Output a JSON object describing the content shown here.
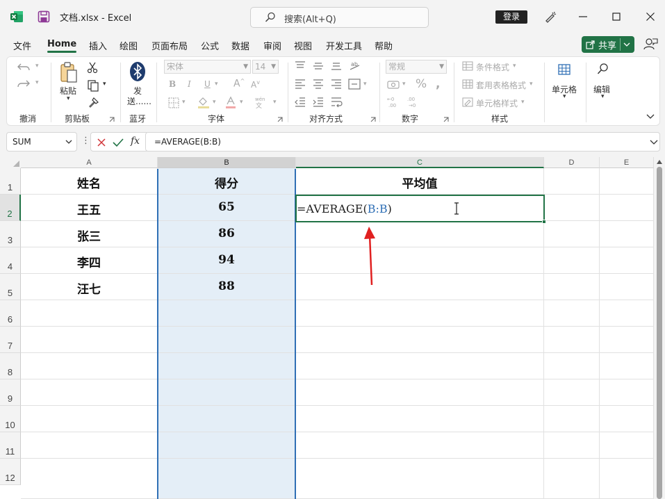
{
  "window": {
    "doc_title": "文档.xlsx  -  Excel",
    "search_placeholder": "搜索(Alt+Q)",
    "login_label": "登录"
  },
  "menu": {
    "tabs": [
      "文件",
      "Home",
      "插入",
      "绘图",
      "页面布局",
      "公式",
      "数据",
      "审阅",
      "视图",
      "开发工具",
      "帮助"
    ],
    "active_tab": "Home",
    "share_label": "共享"
  },
  "ribbon": {
    "groups": {
      "undo": "撤消",
      "clipboard": "剪贴板",
      "bluetooth": "蓝牙",
      "font": "字体",
      "alignment": "对齐方式",
      "number": "数字",
      "styles": "样式"
    },
    "paste_label": "粘贴",
    "send_label_1": "发",
    "send_label_2": "送......",
    "font_name": "宋体",
    "font_size": "14",
    "number_format": "常规",
    "conditional_format": "条件格式",
    "table_format": "套用表格格式",
    "cell_style": "单元格样式",
    "cells_label": "单元格",
    "edit_label": "编辑"
  },
  "formula_bar": {
    "name_box": "SUM",
    "formula": "=AVERAGE(B:B)"
  },
  "grid": {
    "columns": [
      "A",
      "B",
      "C",
      "D",
      "E"
    ],
    "rows": [
      "1",
      "2",
      "3",
      "4",
      "5",
      "6",
      "7",
      "8",
      "9",
      "10",
      "11",
      "12"
    ],
    "header": [
      "姓名",
      "得分",
      "平均值"
    ],
    "data": [
      {
        "name": "王五",
        "score": "65"
      },
      {
        "name": "张三",
        "score": "86"
      },
      {
        "name": "李四",
        "score": "94"
      },
      {
        "name": "汪七",
        "score": "88"
      }
    ],
    "active_cell_formula_prefix": "=AVERAGE",
    "active_cell_formula_open": "(",
    "active_cell_formula_ref": "B:B",
    "active_cell_formula_close": ")"
  },
  "colors": {
    "accent": "#217346",
    "selection_fill": "#e4eef7",
    "ref_blue": "#2f6fb5",
    "arrow_red": "#e02020"
  }
}
